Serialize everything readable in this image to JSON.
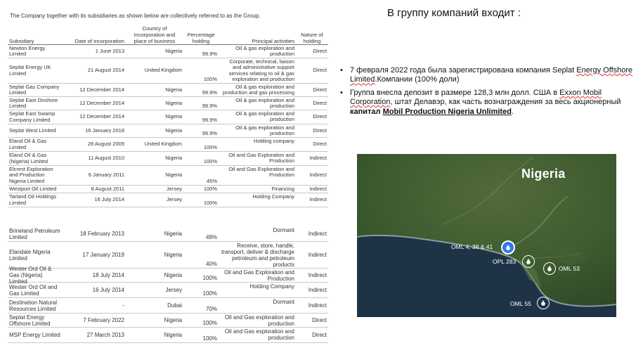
{
  "intro": "The Company together with its subsidiaries as shown below are collectively referred to as the Group.",
  "table": {
    "headers": {
      "subsidiary": "Subsidiary",
      "date": "Date of incorporation",
      "country": "Country of incorporation and place of business",
      "holding": "Percentage holding",
      "activities": "Principal activities",
      "nature": "Nature of holding"
    },
    "rows": [
      {
        "name": "Newton Energy Limited",
        "date": "1 June 2013",
        "country": "Nigeria",
        "pct": "99.9%",
        "activity": "Oil & gas exploration and production",
        "nature": "Direct"
      },
      {
        "name": "Seplat Energy UK Limited",
        "date": "21 August 2014",
        "country": "United Kingdom",
        "pct": "100%",
        "activity": "Corporate, technical, liaison and administrative support services relating to oil & gas exploration and production",
        "nature": "Direct"
      },
      {
        "name": "Seplat Gas Company Limited",
        "date": "12 December 2014",
        "country": "Nigeria",
        "pct": "99.9%",
        "activity": "Oil & gas exploration and production and gas processing",
        "nature": "Direct"
      },
      {
        "name": "Seplat East Onshore Limited",
        "date": "12 December 2014",
        "country": "Nigeria",
        "pct": "99.9%",
        "activity": "Oil & gas exploration and production",
        "nature": "Direct"
      },
      {
        "name": "Seplat East Swamp Company Limited",
        "date": "12 December 2014",
        "country": "Nigeria",
        "pct": "99.9%",
        "activity": "Oil & gas exploration and production",
        "nature": "Direct"
      },
      {
        "name": "Seplat West Limited",
        "date": "16 January 2018",
        "country": "Nigeria",
        "pct": "99.9%",
        "activity": "Oil & gas exploration and production",
        "nature": "Direct"
      },
      {
        "name": "Eland Oil & Gas Limited",
        "date": "28 August 2009",
        "country": "United Kingdom",
        "pct": "100%",
        "activity": "Holding company",
        "nature": "Direct"
      },
      {
        "name": "Eland Oil & Gas (Nigeria) Limited",
        "date": "11 August 2010",
        "country": "Nigeria",
        "pct": "100%",
        "activity": "Oil and Gas Exploration and Production",
        "nature": "Indirect"
      },
      {
        "name": "Elcrest Exploration and Production Nigeria Limited",
        "date": "6 January 2011",
        "country": "Nigeria",
        "pct": "45%",
        "activity": "Oil and Gas Exploration and Production",
        "nature": "Indirect"
      },
      {
        "name": "Westport Oil Limited",
        "date": "8 August 2011",
        "country": "Jersey",
        "pct": "100%",
        "activity": "Financing",
        "nature": "Indirect"
      },
      {
        "name": "Tarland Oil Holdings Limited",
        "date": "16 July 2014",
        "country": "Jersey",
        "pct": "100%",
        "activity": "Holding Company",
        "nature": "Indirect"
      }
    ],
    "rows2": [
      {
        "name": "Brineland Petroleum Limited",
        "date": "18 February 2013",
        "country": "Nigeria",
        "pct": "49%",
        "activity": "Dormant",
        "nature": "Indirect"
      },
      {
        "name": "Elandale Nigeria Limited",
        "date": "17 January 2019",
        "country": "Nigeria",
        "pct": "40%",
        "activity": "Receive, store, handle, transport, deliver & discharge petroleum and petroleum products",
        "nature": "Indirect"
      },
      {
        "name": "Wester Ord Oil & Gas (Nigeria) Limited",
        "date": "18 July 2014",
        "country": "Nigeria",
        "pct": "100%",
        "activity": "Oil and Gas Exploration and Production",
        "nature": "Indirect"
      },
      {
        "name": "Wester Ord Oil and Gas Limited",
        "date": "16 July 2014",
        "country": "Jersey",
        "pct": "100%",
        "activity": "Holding Company",
        "nature": "Indirect"
      },
      {
        "name": "Destination Natural Resources Limited",
        "date": "-",
        "country": "Dubai",
        "pct": "70%",
        "activity": "Dormant",
        "nature": "Indirect"
      },
      {
        "name": "Seplat Energy Offshore Limited",
        "date": "7 February 2022",
        "country": "Nigeria",
        "pct": "100%",
        "activity": "Oil and Gas exploration and production",
        "nature": "Direct"
      },
      {
        "name": "MSP Energy Limited",
        "date": "27 March 2013",
        "country": "Nigeria",
        "pct": "100%",
        "activity": "Oil and Gas exploration and production",
        "nature": "Direct"
      }
    ]
  },
  "right": {
    "title": "В группу компаний входит :",
    "b1_pre": "7 февраля 2022 года была зарегистрирована компания Seplat ",
    "b1_sq1": "Energy Offshore Limited",
    "b1_mid": ".Компании (100% доли)",
    "b2_pre": "Группа внесла депозит в размере 128,3 млн долл. США в ",
    "b2_sq": "Exxon Mobil Corporation",
    "b2_mid": ", штат Делавэр, как часть вознаграждения за весь акционерный ",
    "b2_bold": "капитал ",
    "b2_boldu": "Mobil Production Nigeria Unlimited",
    "b2_end": "."
  },
  "map": {
    "title": "Nigeria",
    "labels": {
      "oml_main": "OML 4, 38 & 41",
      "opl283": "OPL 283",
      "oml53": "OML 53",
      "oml55": "OML 55"
    },
    "colors": {
      "land": "#3d5a2e",
      "sea": "#1f3347",
      "pin": "#2d7be6"
    }
  }
}
